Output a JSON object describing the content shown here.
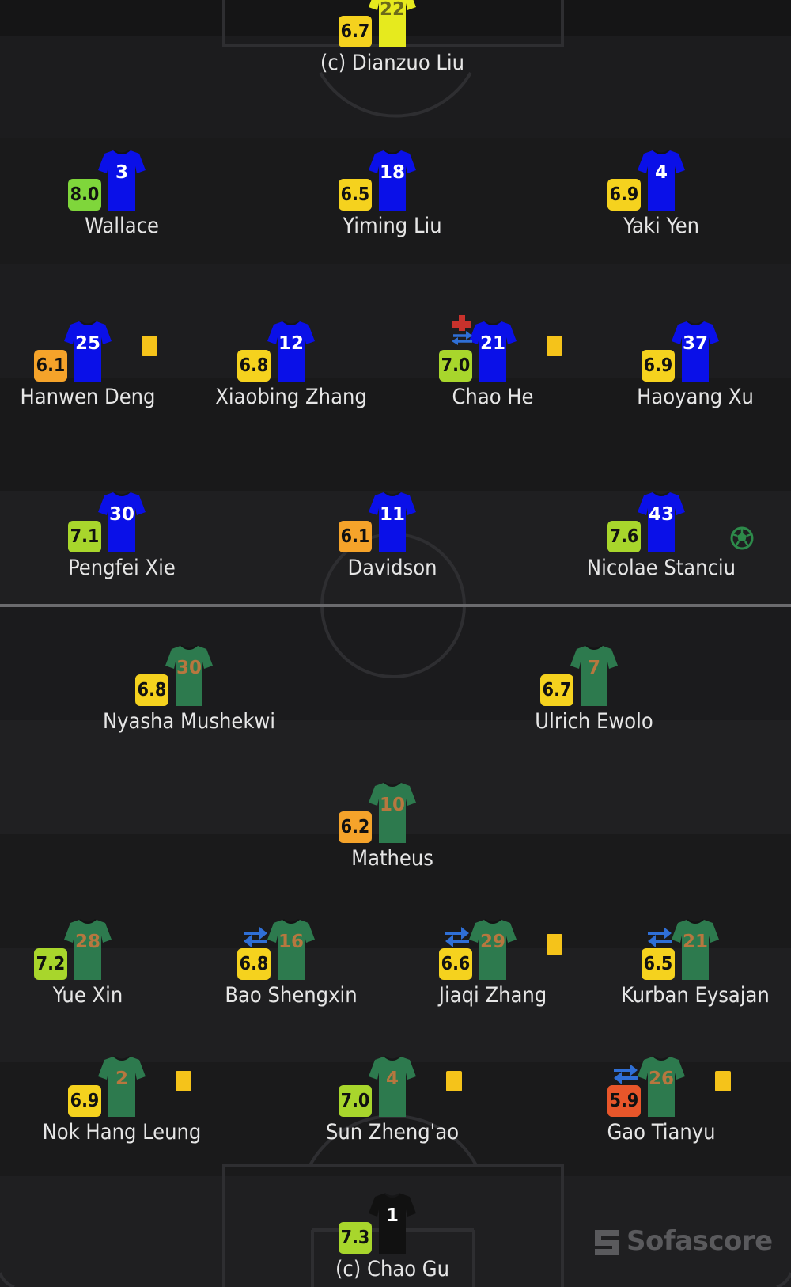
{
  "colors": {
    "bg": "#1a1a1b",
    "stripe_dark": "#1a1a1b",
    "stripe_light": "#202022",
    "lines": "#2e2e31",
    "halfway": "#6b6b6e",
    "home_shirt": "#0a10e8",
    "away_shirt": "#2d7a4e",
    "away_number": "#b7773f",
    "gk_away_shirt": "#e6ea1e",
    "gk_home_shirt": "#111111",
    "card": "#f5c31a",
    "sub_icon": "#2f6fd6",
    "injury_icon": "#c8322c"
  },
  "players": [
    {
      "id": "p01",
      "team": "top",
      "number": "22",
      "name": "(c) Dianzuo Liu",
      "rating": "6.7",
      "rating_color": "#f5d21e",
      "shirt": "#e6ea1e",
      "number_color": "#6b6b1a",
      "icons": []
    },
    {
      "id": "p02",
      "team": "top",
      "number": "3",
      "name": "Wallace",
      "rating": "8.0",
      "rating_color": "#7fd63b",
      "shirt": "#0a10e8",
      "number_color": "#ffffff",
      "icons": []
    },
    {
      "id": "p03",
      "team": "top",
      "number": "18",
      "name": "Yiming Liu",
      "rating": "6.5",
      "rating_color": "#f5d21e",
      "shirt": "#0a10e8",
      "number_color": "#ffffff",
      "icons": []
    },
    {
      "id": "p04",
      "team": "top",
      "number": "4",
      "name": "Yaki Yen",
      "rating": "6.9",
      "rating_color": "#f5d21e",
      "shirt": "#0a10e8",
      "number_color": "#ffffff",
      "icons": []
    },
    {
      "id": "p05",
      "team": "top",
      "number": "25",
      "name": "Hanwen Deng",
      "rating": "6.1",
      "rating_color": "#f5a32a",
      "shirt": "#0a10e8",
      "number_color": "#ffffff",
      "icons": [
        "yellow-card"
      ]
    },
    {
      "id": "p06",
      "team": "top",
      "number": "12",
      "name": "Xiaobing Zhang",
      "rating": "6.8",
      "rating_color": "#f5d21e",
      "shirt": "#0a10e8",
      "number_color": "#ffffff",
      "icons": []
    },
    {
      "id": "p07",
      "team": "top",
      "number": "21",
      "name": "Chao He",
      "rating": "7.0",
      "rating_color": "#a8d62c",
      "shirt": "#0a10e8",
      "number_color": "#ffffff",
      "icons": [
        "injury-substitution",
        "yellow-card"
      ]
    },
    {
      "id": "p08",
      "team": "top",
      "number": "37",
      "name": "Haoyang Xu",
      "rating": "6.9",
      "rating_color": "#f5d21e",
      "shirt": "#0a10e8",
      "number_color": "#ffffff",
      "icons": []
    },
    {
      "id": "p09",
      "team": "top",
      "number": "30",
      "name": "Pengfei Xie",
      "rating": "7.1",
      "rating_color": "#a8d62c",
      "shirt": "#0a10e8",
      "number_color": "#ffffff",
      "icons": []
    },
    {
      "id": "p10",
      "team": "top",
      "number": "11",
      "name": "Davidson",
      "rating": "6.1",
      "rating_color": "#f5a32a",
      "shirt": "#0a10e8",
      "number_color": "#ffffff",
      "icons": []
    },
    {
      "id": "p11",
      "team": "top",
      "number": "43",
      "name": "Nicolae Stanciu",
      "rating": "7.6",
      "rating_color": "#a8d62c",
      "shirt": "#0a10e8",
      "number_color": "#ffffff",
      "icons": [
        "goal"
      ]
    },
    {
      "id": "p12",
      "team": "bottom",
      "number": "30",
      "name": "Nyasha Mushekwi",
      "rating": "6.8",
      "rating_color": "#f5d21e",
      "shirt": "#2d7a4e",
      "number_color": "#b7773f",
      "icons": []
    },
    {
      "id": "p13",
      "team": "bottom",
      "number": "7",
      "name": "Ulrich Ewolo",
      "rating": "6.7",
      "rating_color": "#f5d21e",
      "shirt": "#2d7a4e",
      "number_color": "#b7773f",
      "icons": []
    },
    {
      "id": "p14",
      "team": "bottom",
      "number": "10",
      "name": "Matheus",
      "rating": "6.2",
      "rating_color": "#f5a32a",
      "shirt": "#2d7a4e",
      "number_color": "#b7773f",
      "icons": []
    },
    {
      "id": "p15",
      "team": "bottom",
      "number": "28",
      "name": "Yue Xin",
      "rating": "7.2",
      "rating_color": "#a8d62c",
      "shirt": "#2d7a4e",
      "number_color": "#b7773f",
      "icons": []
    },
    {
      "id": "p16",
      "team": "bottom",
      "number": "16",
      "name": "Bao Shengxin",
      "rating": "6.8",
      "rating_color": "#f5d21e",
      "shirt": "#2d7a4e",
      "number_color": "#b7773f",
      "icons": [
        "substitution"
      ]
    },
    {
      "id": "p17",
      "team": "bottom",
      "number": "29",
      "name": "Jiaqi Zhang",
      "rating": "6.6",
      "rating_color": "#f5d21e",
      "shirt": "#2d7a4e",
      "number_color": "#b7773f",
      "icons": [
        "substitution",
        "yellow-card"
      ]
    },
    {
      "id": "p18",
      "team": "bottom",
      "number": "21",
      "name": "Kurban Eysajan",
      "rating": "6.5",
      "rating_color": "#f5d21e",
      "shirt": "#2d7a4e",
      "number_color": "#b7773f",
      "icons": [
        "substitution"
      ]
    },
    {
      "id": "p19",
      "team": "bottom",
      "number": "2",
      "name": "Nok Hang Leung",
      "rating": "6.9",
      "rating_color": "#f5d21e",
      "shirt": "#2d7a4e",
      "number_color": "#b7773f",
      "icons": [
        "yellow-card"
      ]
    },
    {
      "id": "p20",
      "team": "bottom",
      "number": "4",
      "name": "Sun Zheng'ao",
      "rating": "7.0",
      "rating_color": "#a8d62c",
      "shirt": "#2d7a4e",
      "number_color": "#b7773f",
      "icons": [
        "yellow-card"
      ]
    },
    {
      "id": "p21",
      "team": "bottom",
      "number": "26",
      "name": "Gao Tianyu",
      "rating": "5.9",
      "rating_color": "#e8562a",
      "shirt": "#2d7a4e",
      "number_color": "#b7773f",
      "icons": [
        "substitution",
        "yellow-card"
      ]
    },
    {
      "id": "p22",
      "team": "bottom",
      "number": "1",
      "name": "(c) Chao Gu",
      "rating": "7.3",
      "rating_color": "#a8d62c",
      "shirt": "#111111",
      "number_color": "#ffffff",
      "icons": []
    }
  ],
  "watermark": {
    "text": "Sofascore"
  }
}
